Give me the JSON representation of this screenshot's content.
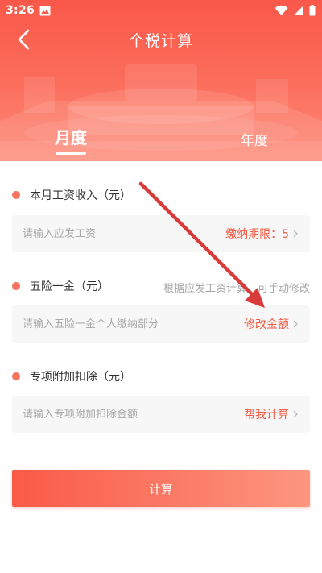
{
  "status_bar": {
    "time": "3:26"
  },
  "header": {
    "title": "个税计算",
    "tabs": [
      {
        "label": "月度",
        "active": true
      },
      {
        "label": "年度",
        "active": false
      }
    ]
  },
  "form": {
    "salary": {
      "label": "本月工资收入（元）",
      "placeholder": "请输入应发工资",
      "action": "缴纳期限：5"
    },
    "insurance": {
      "label": "五险一金（元）",
      "hint": "根据应发工资计算，可手动修改",
      "placeholder": "请输入五险一金个人缴纳部分",
      "action": "修改金额"
    },
    "deduction": {
      "label": "专项附加扣除（元）",
      "placeholder": "请输入专项附加扣除金额",
      "action": "帮我计算"
    },
    "submit_label": "计算"
  },
  "colors": {
    "accent": "#f25a43",
    "dot": "#f6735f",
    "annotation_arrow": "#d93a3a"
  }
}
